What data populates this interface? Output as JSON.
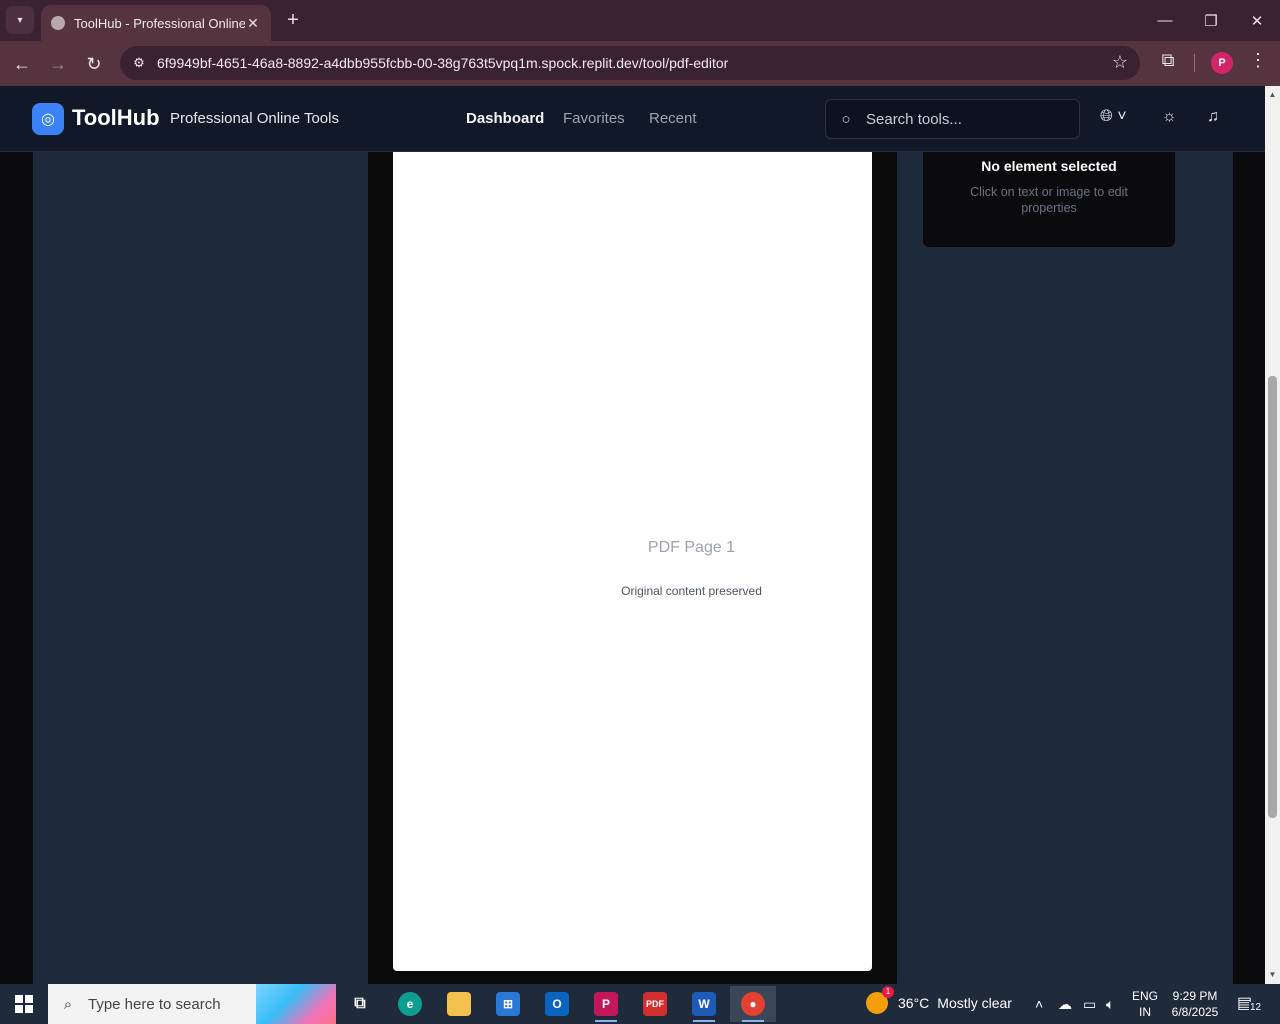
{
  "browser": {
    "tab_title": "ToolHub - Professional Online T",
    "url": "6f9949bf-4651-46a8-8892-a4dbb955fcbb-00-38g763t5vpq1m.spock.replit.dev/tool/pdf-editor",
    "profile_initial": "P"
  },
  "header": {
    "logo": "ToolHub",
    "tagline": "Professional Online Tools",
    "nav": [
      "Dashboard",
      "Favorites",
      "Recent"
    ],
    "active_nav": "Dashboard",
    "search_placeholder": "Search tools..."
  },
  "editor": {
    "page_label": "PDF Page 1",
    "page_subtitle": "Original content preserved",
    "properties_title": "No element selected",
    "properties_hint": "Click on text or image to edit properties"
  },
  "taskbar": {
    "search_placeholder": "Type here to search",
    "weather_temp": "36°C",
    "weather_desc": "Mostly clear",
    "weather_badge": "1",
    "lang_line1": "ENG",
    "lang_line2": "IN",
    "time": "9:29 PM",
    "date": "6/8/2025",
    "notification_count": "12"
  },
  "colors": {
    "accent": "#3b82f6",
    "panel": "#1e293b",
    "header_bg": "#111827",
    "browser_chrome": "#55343f"
  }
}
